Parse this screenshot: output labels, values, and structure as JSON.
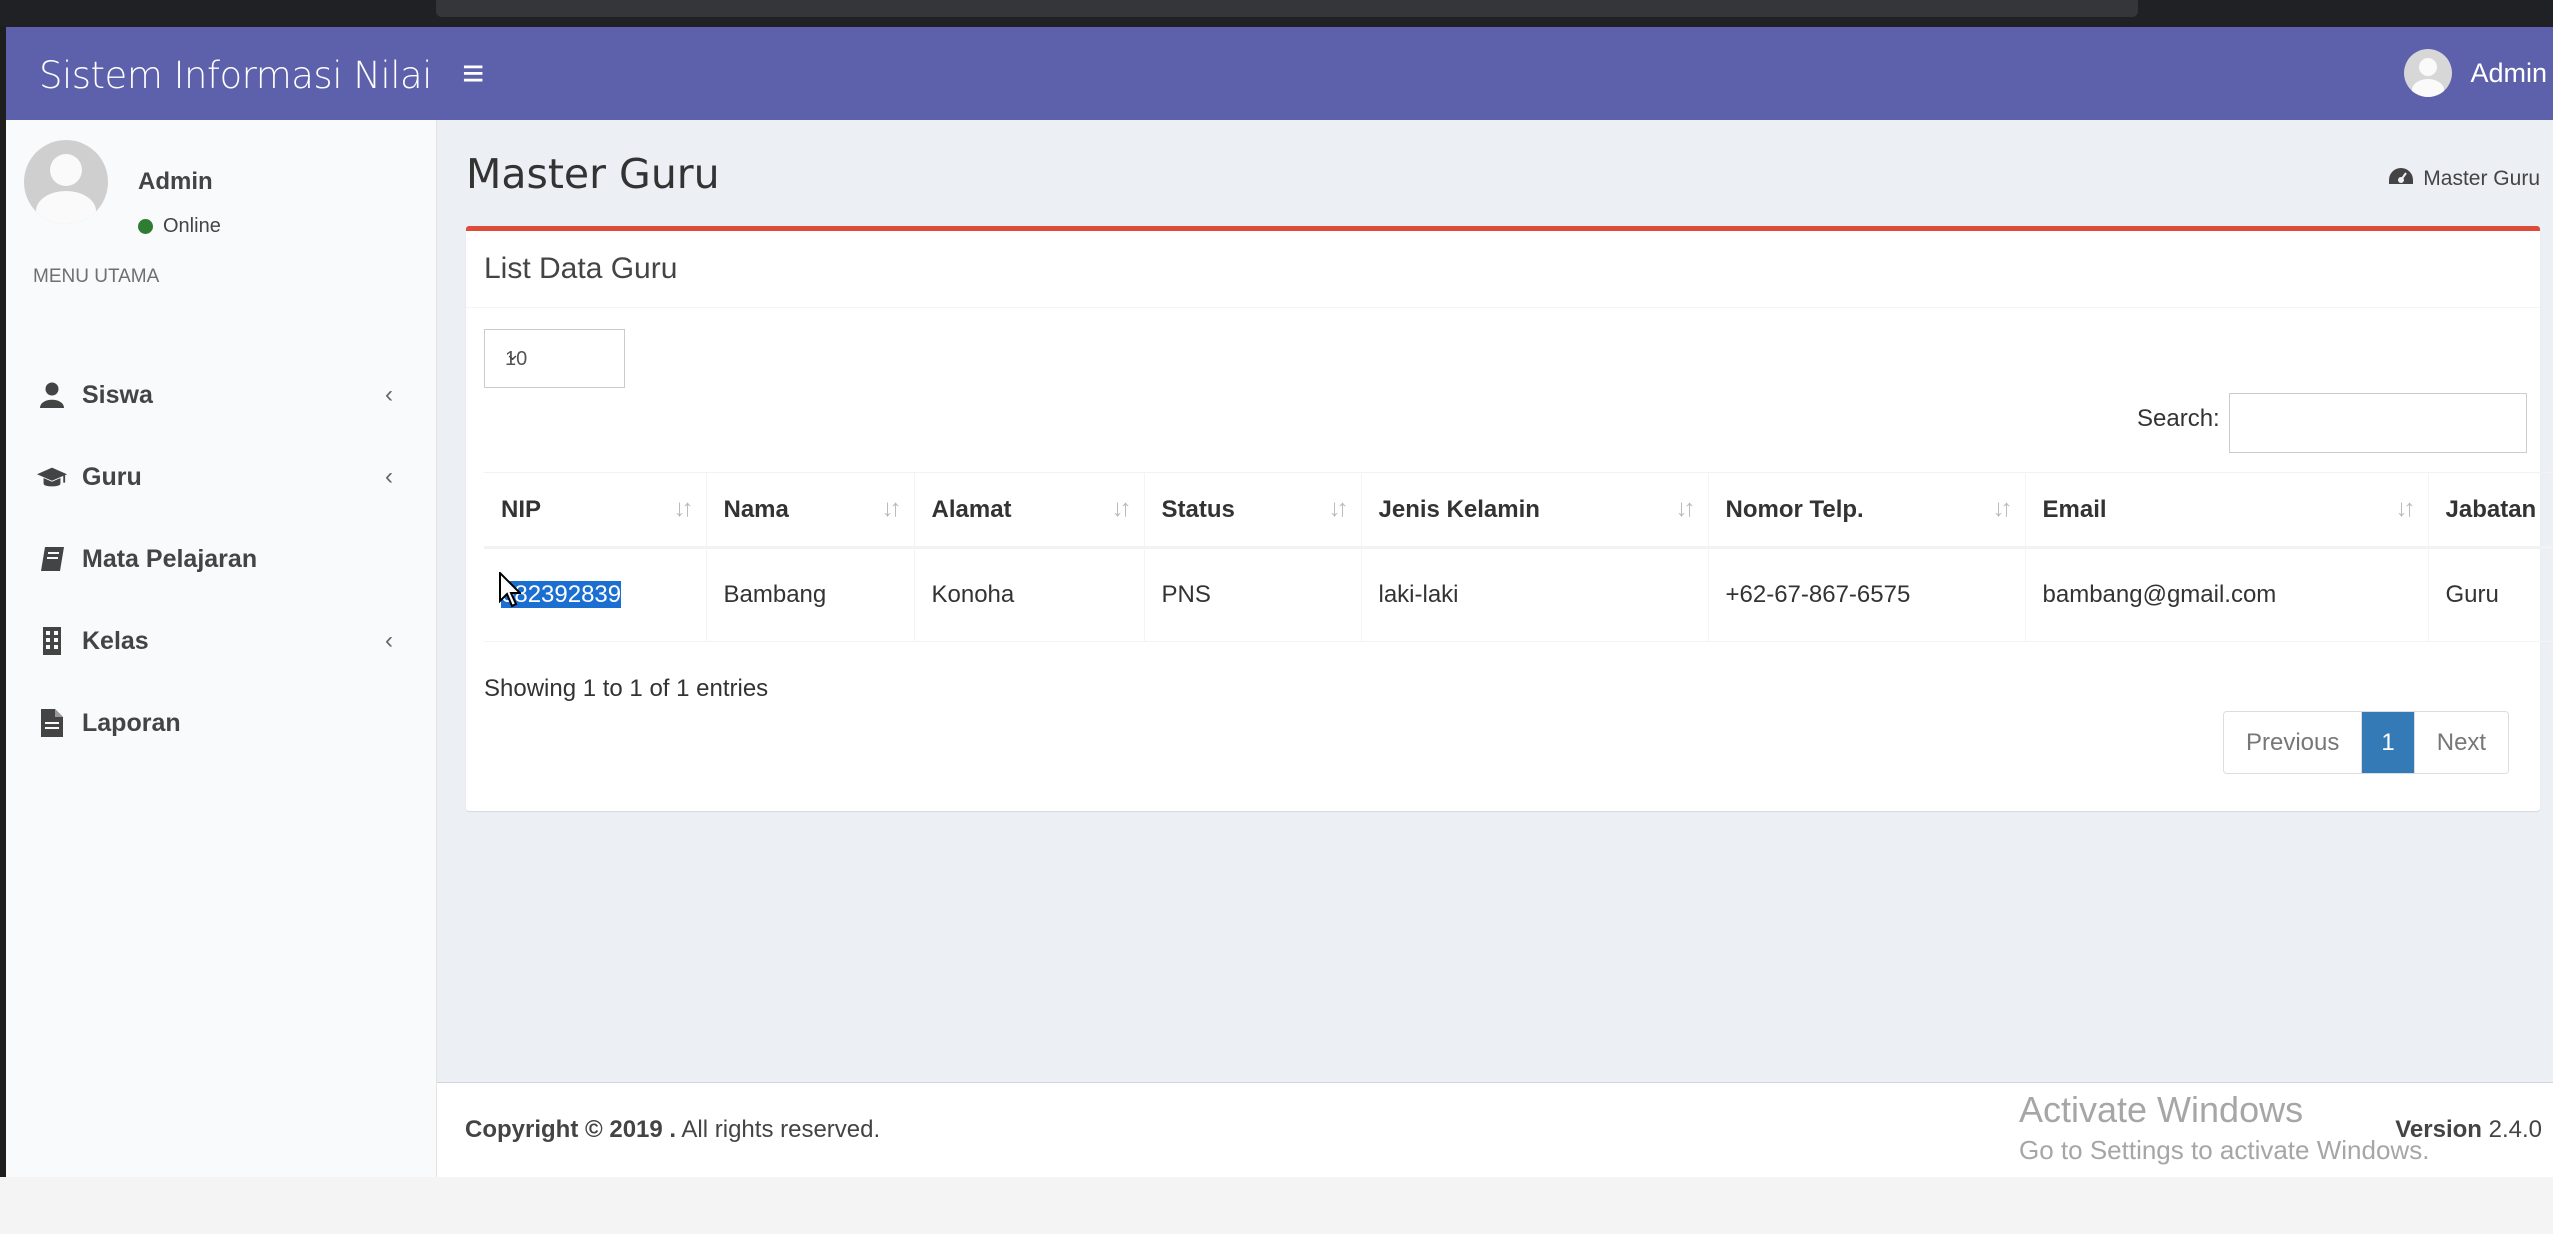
{
  "app": {
    "logo_text": "Sistem Informasi Nilai",
    "user_name": "Admin"
  },
  "sidebar": {
    "user_name": "Admin",
    "status": "Online",
    "menu_header": "MENU UTAMA",
    "items": [
      {
        "label": "Siswa",
        "icon": "user-icon",
        "has_children": true
      },
      {
        "label": "Guru",
        "icon": "graduation-cap-icon",
        "has_children": true
      },
      {
        "label": "Mata Pelajaran",
        "icon": "book-icon",
        "has_children": false
      },
      {
        "label": "Kelas",
        "icon": "building-icon",
        "has_children": true
      },
      {
        "label": "Laporan",
        "icon": "file-icon",
        "has_children": false
      }
    ]
  },
  "page": {
    "title": "Master Guru",
    "breadcrumb": "Master Guru"
  },
  "box": {
    "title": "List Data Guru",
    "length_value": "10",
    "search_label": "Search:",
    "search_value": ""
  },
  "table": {
    "headers": [
      "NIP",
      "Nama",
      "Alamat",
      "Status",
      "Jenis Kelamin",
      "Nomor Telp.",
      "Email",
      "Jabatan"
    ],
    "rows": [
      {
        "nip": "082392839",
        "nama": "Bambang",
        "alamat": "Konoha",
        "status": "PNS",
        "jenis_kelamin": "laki-laki",
        "telp": "+62-67-867-6575",
        "email": "bambang@gmail.com",
        "jabatan": "Guru"
      }
    ],
    "info": "Showing 1 to 1 of 1 entries"
  },
  "pagination": {
    "previous": "Previous",
    "current": "1",
    "next": "Next"
  },
  "footer": {
    "copyright_bold": "Copyright © 2019 .",
    "copyright_rest": " All rights reserved.",
    "version_label": "Version",
    "version_value": " 2.4.0"
  },
  "watermark": {
    "line1": "Activate Windows",
    "line2": "Go to Settings to activate Windows."
  },
  "colors": {
    "header": "#5d60aa",
    "box_accent": "#dd4b39",
    "pagination_active": "#337ab7",
    "selection": "#1a6fd0"
  }
}
